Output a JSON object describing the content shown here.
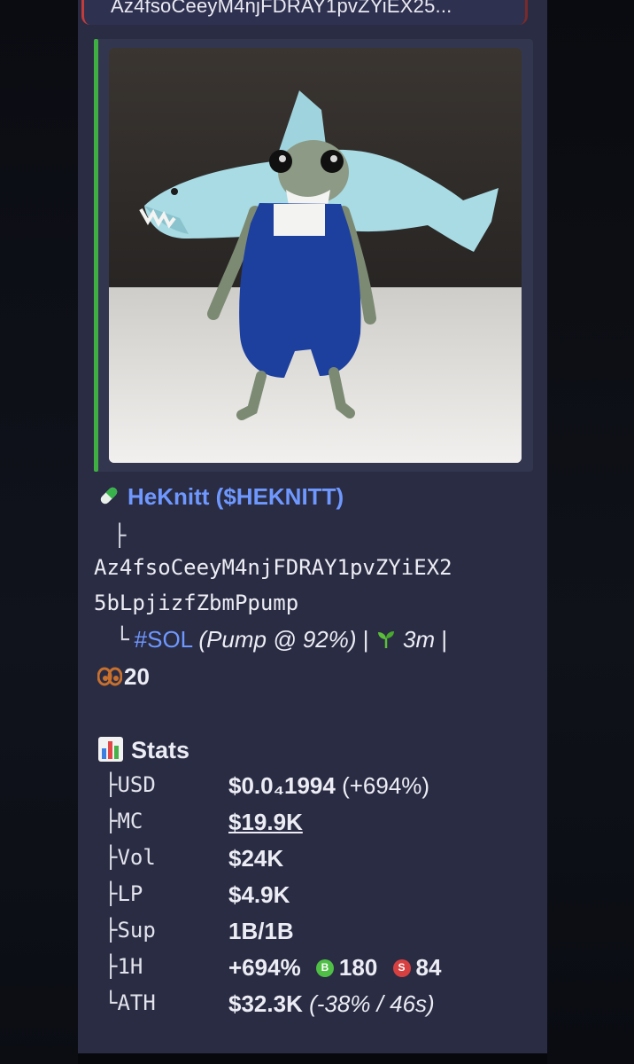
{
  "message": {
    "reply_preview": "Az4fsoCeeyM4njFDRAY1pvZYiEX25...",
    "token": {
      "name": "HeKnitt",
      "ticker": "($HEKNITT)",
      "address_line1": "Az4fsoCeeyM4njFDRAY1pvZYiEX2",
      "address_line2": "5bLpjizfZbmPpump",
      "tree_top": "├",
      "chain_corner": "└",
      "chain_tag": "#SOL",
      "pump_text": "(Pump @ 92%)",
      "sep": "|",
      "age": "3m",
      "sep2": "|",
      "holders_count": "20"
    },
    "stats": {
      "title": "Stats",
      "rows": [
        {
          "key": "├USD",
          "value": "$0.0₄1994",
          "extra": "(+694%)"
        },
        {
          "key": "├MC",
          "value": "$19.9K",
          "extra": ""
        },
        {
          "key": "├Vol",
          "value": "$24K",
          "extra": ""
        },
        {
          "key": "├LP",
          "value": "$4.9K",
          "extra": ""
        },
        {
          "key": "├Sup",
          "value": "1B/1B",
          "extra": ""
        },
        {
          "key": "├1H",
          "value": "+694%",
          "buys": "180",
          "sells": "84",
          "buy_badge": "B",
          "sell_badge": "S"
        },
        {
          "key": "└ATH",
          "value": "$32.3K",
          "extra": "(-38% / 46s)"
        }
      ]
    }
  },
  "icons": [
    "pill-icon",
    "seedling-icon",
    "eyes-icon",
    "bar-chart-icon",
    "buy-badge-icon",
    "sell-badge-icon"
  ],
  "colors": {
    "link": "#6f98ff",
    "accent_bar": "#3fae43",
    "card_bg": "#2a2c44",
    "buy": "#4fbf46",
    "sell": "#d64040"
  }
}
